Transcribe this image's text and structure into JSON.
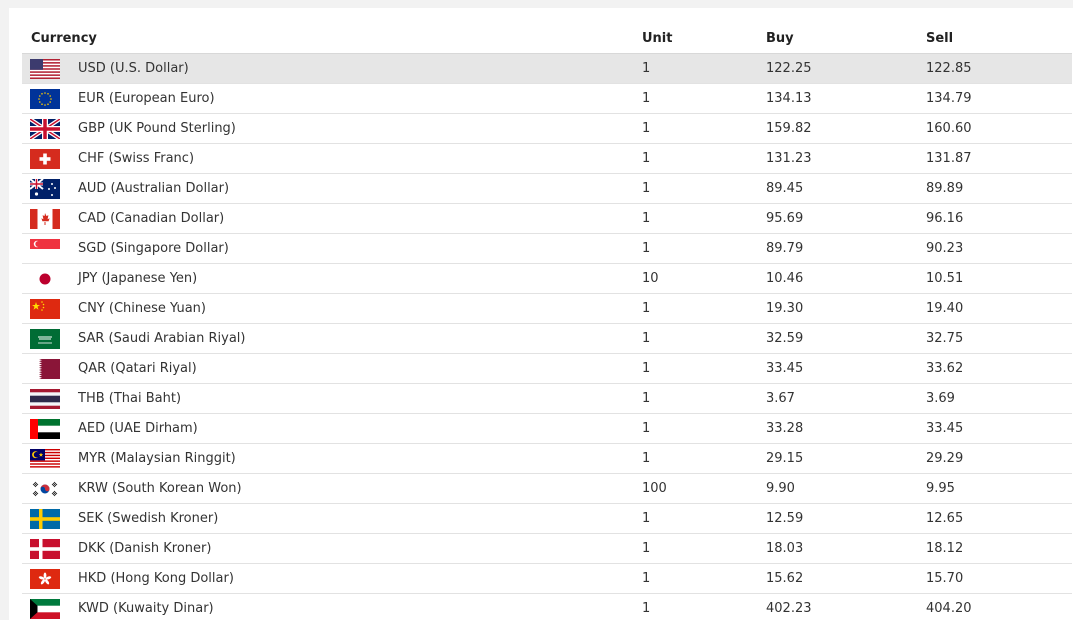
{
  "headers": {
    "currency": "Currency",
    "unit": "Unit",
    "buy": "Buy",
    "sell": "Sell"
  },
  "rows": [
    {
      "flag": "us-flag-icon",
      "currency": "USD (U.S. Dollar)",
      "unit": "1",
      "buy": "122.25",
      "sell": "122.85",
      "highlighted": true
    },
    {
      "flag": "eu-flag-icon",
      "currency": "EUR (European Euro)",
      "unit": "1",
      "buy": "134.13",
      "sell": "134.79"
    },
    {
      "flag": "uk-flag-icon",
      "currency": "GBP (UK Pound Sterling)",
      "unit": "1",
      "buy": "159.82",
      "sell": "160.60"
    },
    {
      "flag": "ch-flag-icon",
      "currency": "CHF (Swiss Franc)",
      "unit": "1",
      "buy": "131.23",
      "sell": "131.87"
    },
    {
      "flag": "au-flag-icon",
      "currency": "AUD (Australian Dollar)",
      "unit": "1",
      "buy": "89.45",
      "sell": "89.89"
    },
    {
      "flag": "ca-flag-icon",
      "currency": "CAD (Canadian Dollar)",
      "unit": "1",
      "buy": "95.69",
      "sell": "96.16"
    },
    {
      "flag": "sg-flag-icon",
      "currency": "SGD (Singapore Dollar)",
      "unit": "1",
      "buy": "89.79",
      "sell": "90.23"
    },
    {
      "flag": "jp-flag-icon",
      "currency": "JPY (Japanese Yen)",
      "unit": "10",
      "buy": "10.46",
      "sell": "10.51"
    },
    {
      "flag": "cn-flag-icon",
      "currency": "CNY (Chinese Yuan)",
      "unit": "1",
      "buy": "19.30",
      "sell": "19.40"
    },
    {
      "flag": "sa-flag-icon",
      "currency": "SAR (Saudi Arabian Riyal)",
      "unit": "1",
      "buy": "32.59",
      "sell": "32.75"
    },
    {
      "flag": "qa-flag-icon",
      "currency": "QAR (Qatari Riyal)",
      "unit": "1",
      "buy": "33.45",
      "sell": "33.62"
    },
    {
      "flag": "th-flag-icon",
      "currency": "THB (Thai Baht)",
      "unit": "1",
      "buy": "3.67",
      "sell": "3.69"
    },
    {
      "flag": "ae-flag-icon",
      "currency": "AED (UAE Dirham)",
      "unit": "1",
      "buy": "33.28",
      "sell": "33.45"
    },
    {
      "flag": "my-flag-icon",
      "currency": "MYR (Malaysian Ringgit)",
      "unit": "1",
      "buy": "29.15",
      "sell": "29.29"
    },
    {
      "flag": "kr-flag-icon",
      "currency": "KRW (South Korean Won)",
      "unit": "100",
      "buy": "9.90",
      "sell": "9.95"
    },
    {
      "flag": "se-flag-icon",
      "currency": "SEK (Swedish Kroner)",
      "unit": "1",
      "buy": "12.59",
      "sell": "12.65"
    },
    {
      "flag": "dk-flag-icon",
      "currency": "DKK (Danish Kroner)",
      "unit": "1",
      "buy": "18.03",
      "sell": "18.12"
    },
    {
      "flag": "hk-flag-icon",
      "currency": "HKD (Hong Kong Dollar)",
      "unit": "1",
      "buy": "15.62",
      "sell": "15.70"
    },
    {
      "flag": "kw-flag-icon",
      "currency": "KWD (Kuwaity Dinar)",
      "unit": "1",
      "buy": "402.23",
      "sell": "404.20"
    }
  ]
}
